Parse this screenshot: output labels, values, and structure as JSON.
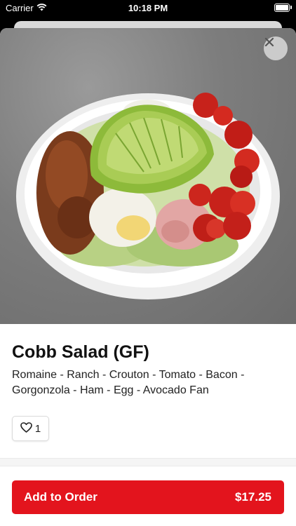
{
  "status": {
    "carrier": "Carrier",
    "time": "10:18 PM"
  },
  "item": {
    "title": "Cobb Salad (GF)",
    "description": "Romaine - Ranch - Crouton - Tomato - Bacon - Gorgonzola - Ham - Egg - Avocado Fan",
    "like_count": "1"
  },
  "order": {
    "label": "Add to Order",
    "price": "$17.25"
  },
  "colors": {
    "accent": "#e3141d"
  },
  "icons": {
    "close": "close-icon",
    "like": "heart-outline-icon",
    "wifi": "wifi-icon",
    "battery": "battery-icon"
  }
}
